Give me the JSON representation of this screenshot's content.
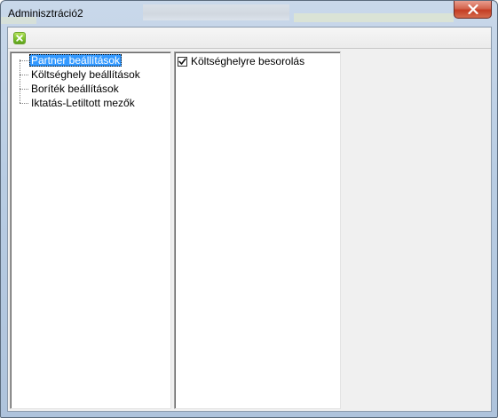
{
  "window": {
    "title": "Adminisztráció2",
    "close_symbol": "✕"
  },
  "toolbar": {
    "buttons": [
      {
        "icon": "close-green-icon",
        "accent": "#7cc12b"
      }
    ]
  },
  "tree": {
    "items": [
      {
        "label": "Partner beállítások",
        "selected": true
      },
      {
        "label": "Költséghely beállítások",
        "selected": false
      },
      {
        "label": "Boríték beállítások",
        "selected": false
      },
      {
        "label": "Iktatás-Letiltott mezők",
        "selected": false
      }
    ]
  },
  "settings": {
    "items": [
      {
        "label": "Költséghelyre besorolás",
        "checked": true
      }
    ]
  },
  "colors": {
    "selection": "#3399ff",
    "close_button": "#c43c23"
  }
}
